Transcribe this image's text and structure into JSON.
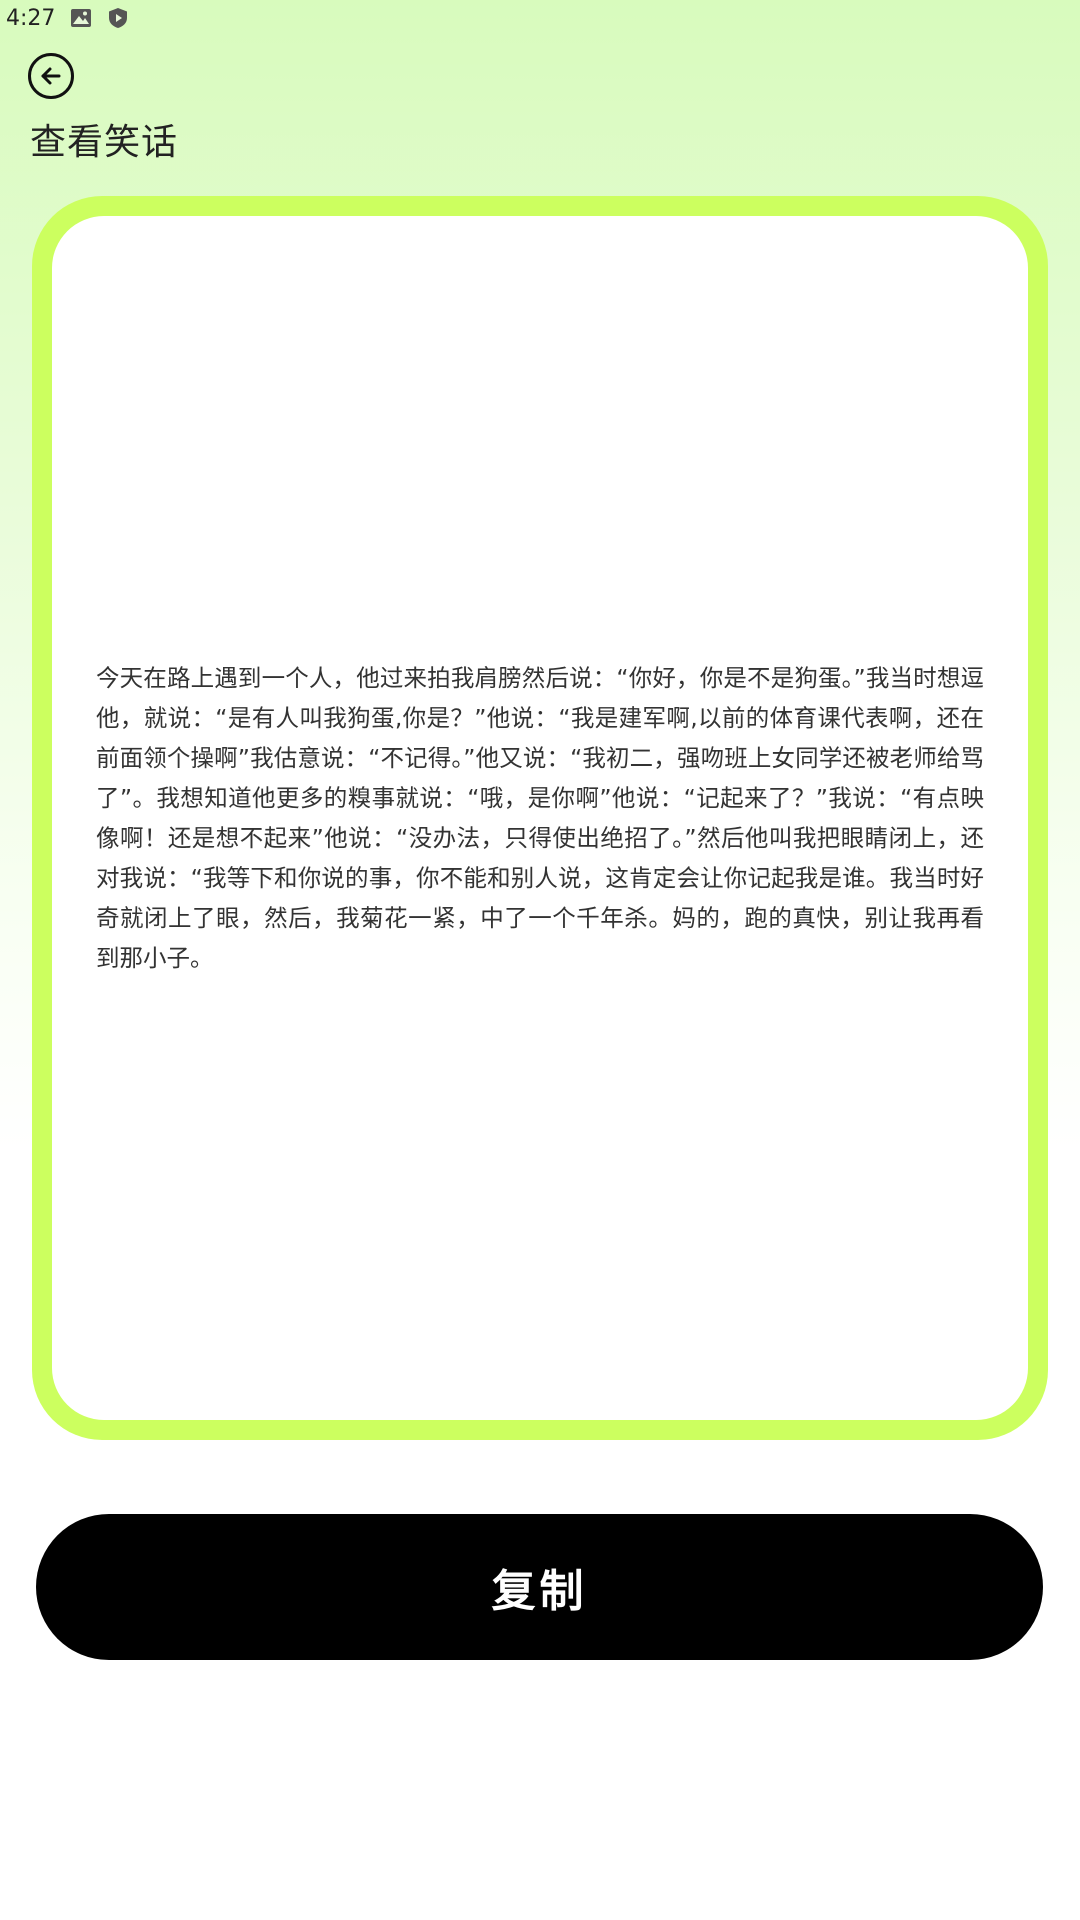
{
  "status_bar": {
    "time": "4:27",
    "icons": [
      "image-icon",
      "shield-icon"
    ]
  },
  "header": {
    "back_icon": "arrow-left-circle-icon",
    "title": "查看笑话"
  },
  "joke": {
    "text": "今天在路上遇到一个人，他过来拍我肩膀然后说：“你好，你是不是狗蛋。”我当时想逗他，就说：“是有人叫我狗蛋,你是？”他说：“我是建军啊,以前的体育课代表啊，还在前面领个操啊”我估意说：“不记得。”他又说：“我初二，强吻班上女同学还被老师给骂了”。我想知道他更多的糗事就说：“哦，是你啊”他说：“记起来了？”我说：“有点映像啊！还是想不起来”他说：“没办法，只得使出绝招了。”然后他叫我把眼睛闭上，还对我说：“我等下和你说的事，你不能和别人说，这肯定会让你记起我是谁。我当时好奇就闭上了眼，然后，我菊花一紧，中了一个千年杀。妈的，跑的真快，别让我再看到那小子。"
  },
  "actions": {
    "copy_label": "复制"
  },
  "colors": {
    "card_border": "#ccff5f",
    "button_bg": "#000000",
    "gradient_top": "#d8fbbd"
  }
}
